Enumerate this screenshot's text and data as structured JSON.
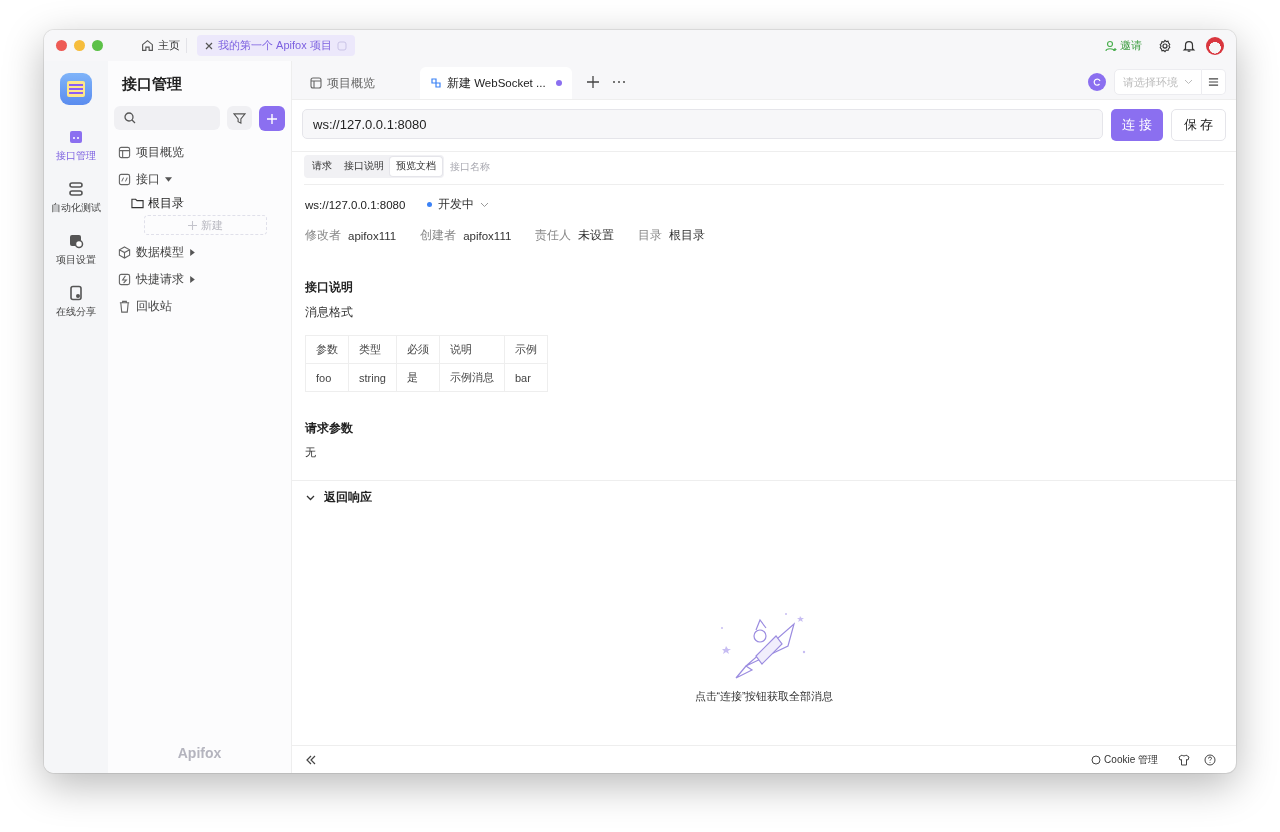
{
  "titlebar": {
    "home_tab": "主页",
    "project_tab": "我的第一个 Apifox 项目",
    "invite": "邀请"
  },
  "rail": [
    {
      "label": "接口管理",
      "selected": true,
      "kind": "api"
    },
    {
      "label": "自动化测试",
      "selected": false,
      "kind": "test"
    },
    {
      "label": "项目设置",
      "selected": false,
      "kind": "settings"
    },
    {
      "label": "在线分享",
      "selected": false,
      "kind": "share"
    }
  ],
  "sidebar": {
    "title": "接口管理",
    "new_label": "新建",
    "brand": "Apifox",
    "items": [
      {
        "label": "项目概览",
        "kind": "overview"
      },
      {
        "label": "接口",
        "kind": "api",
        "expanded": true,
        "children": [
          {
            "label": "根目录"
          }
        ]
      },
      {
        "label": "数据模型",
        "kind": "model",
        "expanded": false
      },
      {
        "label": "快捷请求",
        "kind": "quick",
        "expanded": false
      },
      {
        "label": "回收站",
        "kind": "trash"
      }
    ]
  },
  "tabs": [
    {
      "label": "项目概览",
      "kind": "overview",
      "selected": false,
      "unsaved": false
    },
    {
      "label": "新建 WebSocket ...",
      "kind": "websocket",
      "selected": true,
      "unsaved": true
    }
  ],
  "environment": {
    "placeholder": "请选择环境"
  },
  "url": {
    "value": "ws://127.0.0.1:8080"
  },
  "buttons": {
    "connect": "连 接",
    "save": "保 存"
  },
  "subtabs": [
    {
      "label": "请求",
      "selected": false
    },
    {
      "label": "接口说明",
      "selected": false
    },
    {
      "label": "预览文档",
      "selected": true
    }
  ],
  "name_field": {
    "placeholder": "接口名称"
  },
  "doc": {
    "url": "ws://127.0.0.1:8080",
    "status": "开发中",
    "meta": [
      {
        "label": "修改者",
        "value": "apifox111"
      },
      {
        "label": "创建者",
        "value": "apifox111"
      },
      {
        "label": "责任人",
        "value": "未设置"
      },
      {
        "label": "目录",
        "value": "根目录"
      }
    ],
    "description_title": "接口说明",
    "description_text": "消息格式",
    "table": {
      "columns": [
        "参数",
        "类型",
        "必须",
        "说明",
        "示例"
      ],
      "rows": [
        [
          "foo",
          "string",
          "是",
          "示例消息",
          "bar"
        ]
      ]
    },
    "params_title": "请求参数",
    "params_text": "无"
  },
  "response": {
    "title": "返回响应",
    "expanded": true,
    "empty_text": "点击“连接”按钮获取全部消息"
  },
  "status_bar": {
    "cookie": "Cookie 管理"
  }
}
